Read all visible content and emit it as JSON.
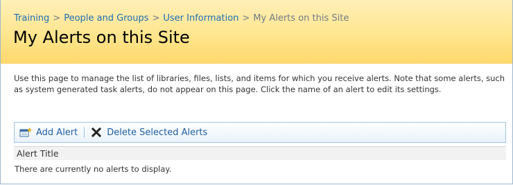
{
  "breadcrumb": {
    "items": [
      "Training",
      "People and Groups",
      "User Information"
    ],
    "current": "My Alerts on this Site",
    "separator": ">"
  },
  "page": {
    "title": "My Alerts on this Site",
    "description": "Use this page to manage the list of libraries, files, lists, and items for which you receive alerts. Note that some alerts, such as system generated task alerts, do not appear on this page. Click the name of an alert to edit its settings."
  },
  "toolbar": {
    "add_alert_label": "Add Alert",
    "add_alert_icon": "add-alert-icon",
    "delete_label": "Delete Selected Alerts",
    "delete_icon": "delete-x-icon"
  },
  "list": {
    "columns": [
      "Alert Title"
    ],
    "empty_message": "There are currently no alerts to display."
  },
  "colors": {
    "header_bg": "#ffe48a",
    "link": "#1f6fb5",
    "toolbar_border": "#9fc3e3"
  }
}
